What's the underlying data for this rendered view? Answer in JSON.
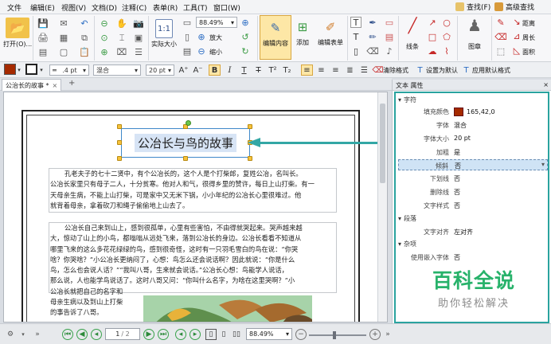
{
  "menu": {
    "items": [
      "文件",
      "编辑(E)",
      "视图(V)",
      "文档(D)",
      "注释(C)",
      "表单(R)",
      "工具(T)",
      "窗口(W)"
    ],
    "right_search": "查找(F)",
    "right_advanced": "高级查找"
  },
  "ribbon": {
    "open_label": "打开(O)...",
    "zoom_value": "88.49%",
    "actual_size": "实际大小",
    "zoom_in": "放大",
    "zoom_out": "缩小",
    "edit_content": "编辑内容",
    "add": "添加",
    "edit_form": "编辑表单",
    "line": "线条",
    "stamp": "图章",
    "distance": "距离",
    "perimeter": "周长",
    "area": "面积"
  },
  "format_bar": {
    "fill_color": "#a52a00",
    "stroke_width": ".4 pt",
    "font_name": "混合",
    "font_size": "20 pt",
    "clear_format": "清除格式",
    "set_default": "设置为默认",
    "apply_default": "应用默认格式"
  },
  "tabs": {
    "doc_title": "公治长的故事 *"
  },
  "document": {
    "title": "公冶长与鸟的故事",
    "para1": [
      "孔老夫子的七十二贤中，有个公冶长的，这个人是个打柴郎，复姓公冶，名叫长。",
      "公冶长家里只有母子二人，十分贫寒。他对人和气，很得乡里的赞许，每日上山打柴。有一",
      "天母亲生病，不能上山打柴，可是家中又无米下锅，小小年纪的公冶长心里很难过。他",
      "就背着母亲，拿着砍刀和绳子偷偷地上山去了。"
    ],
    "para2": [
      "公冶长自己来到山上，感到很孤单，心里有些害怕，不由得就哭起来。哭声越来越",
      "大，惊动了山上的小鸟，都嗡嗡从远处飞来，落到公冶长的身边。公冶长看看不知道从",
      "哪里飞来的这么多花花绿绿的鸟，感到很奇怪，这时有一只羽毛雪白的鸟在说：“你哭",
      "啥？你哭啥？”小公冶长更纳闷了，心想：鸟怎么还会说话啊？因此就说：“你是什么",
      "鸟，怎么也会说人话？”“我叫八哥，生来就会说话。”公冶长心想：鸟能学人说话，",
      "那么说，人也能学鸟说话了。这时八哥又问：“你叫什么名字，为啥在这里哭啊？”小",
      "公冶长就把自己的名字和",
      "母亲生病以及到山上打柴",
      "的事告诉了八哥。"
    ]
  },
  "status_bar": {
    "page_current": "1",
    "page_total": "/ 2",
    "zoom": "88.49%"
  },
  "panel": {
    "header": "文本 属性",
    "sections": {
      "char": "字符",
      "para": "段落",
      "misc": "杂项"
    },
    "rows": [
      {
        "key": "填充颜色",
        "value": "165,42,0"
      },
      {
        "key": "字体",
        "value": "混合"
      },
      {
        "key": "字体大小",
        "value": "20 pt"
      },
      {
        "key": "加粗",
        "value": "是"
      },
      {
        "key": "倾斜",
        "value": "否"
      },
      {
        "key": "下划线",
        "value": "否"
      },
      {
        "key": "删除线",
        "value": "否"
      },
      {
        "key": "文字样式",
        "value": "否"
      }
    ],
    "para_rows": [
      {
        "key": "文字对齐",
        "value": "左对齐"
      }
    ],
    "misc_rows": [
      {
        "key": "使用嵌入字体",
        "value": "否"
      }
    ],
    "fill_color_hex": "#a52a00"
  },
  "watermark": {
    "line1": "百科全说",
    "line2": "助你轻松解决"
  },
  "colors": {
    "accent_teal": "#2aa39f",
    "selection_blue": "#3f88c9",
    "watermark_green": "#27b26a"
  }
}
